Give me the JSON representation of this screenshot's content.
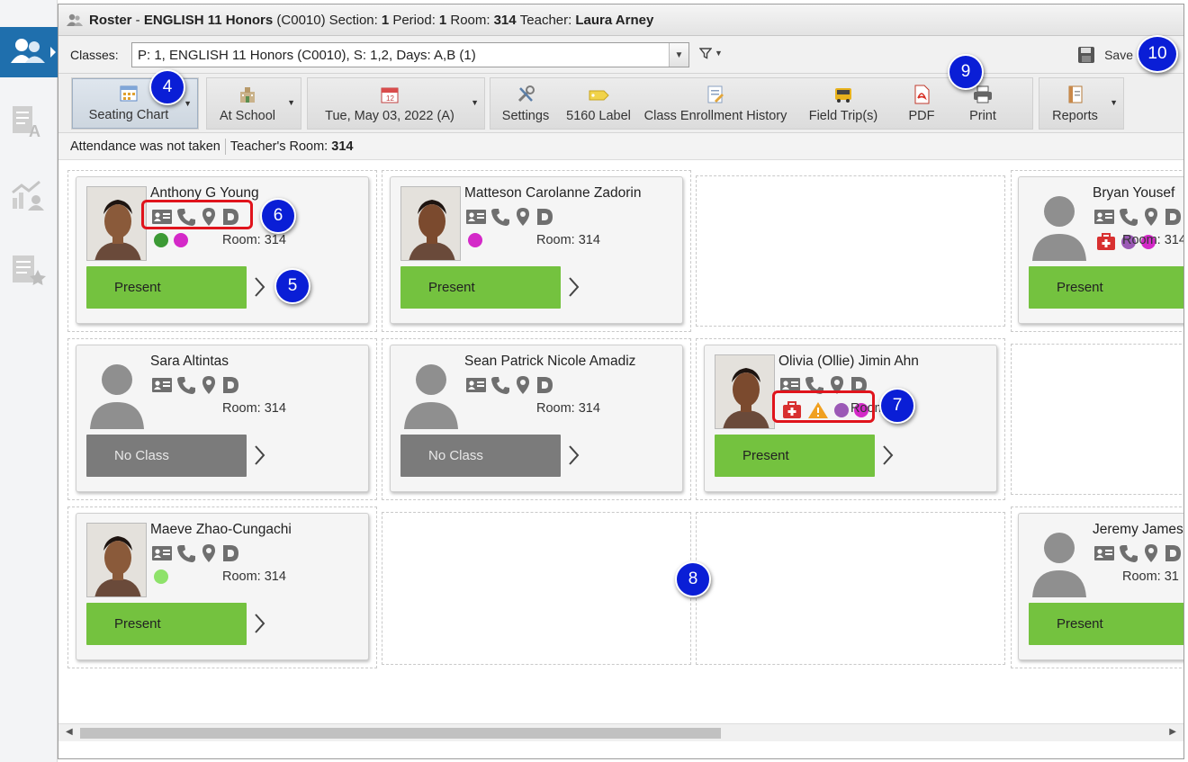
{
  "window": {
    "title_app": "Roster",
    "title_course": "ENGLISH 11 Honors",
    "title_code": "(C0010)",
    "section_label": "Section:",
    "section_value": "1",
    "period_label": "Period:",
    "period_value": "1",
    "room_label": "Room:",
    "room_value": "314",
    "teacher_label": "Teacher:",
    "teacher_value": "Laura Arney"
  },
  "classbar": {
    "label": "Classes:",
    "selected": "P: 1, ENGLISH 11 Honors (C0010), S: 1,2, Days: A,B (1)",
    "save_label": "Save"
  },
  "toolbar": {
    "seating_chart": "Seating Chart",
    "at_school": "At School",
    "date": "Tue, May 03, 2022 (A)",
    "settings": "Settings",
    "label_5160": "5160 Label",
    "enrollment_history": "Class Enrollment History",
    "field_trips": "Field Trip(s)",
    "pdf": "PDF",
    "print": "Print",
    "reports": "Reports"
  },
  "status": {
    "attendance_text": "Attendance was not taken",
    "teacher_room_label": "Teacher's Room:",
    "teacher_room_value": "314"
  },
  "students": [
    {
      "name": "Anthony G Young",
      "room": "Room: 314",
      "status": "Present",
      "dots": [
        "#3c9a35",
        "#d429c8"
      ],
      "photo": "male"
    },
    {
      "name": "Matteson Carolanne Zadorin",
      "room": "Room: 314",
      "status": "Present",
      "dots": [
        "#d429c8"
      ],
      "photo": "female"
    },
    {
      "name": "Bryan Yousef",
      "room": "Room: 314",
      "status": "Present",
      "dots": [
        "#9b59b6",
        "#d429c8"
      ],
      "photo": "none"
    },
    {
      "name": "Sara Altintas",
      "room": "Room: 314",
      "status": "No Class",
      "dots": [],
      "photo": "none"
    },
    {
      "name": "Sean Patrick Nicole Amadiz",
      "room": "Room: 314",
      "status": "No Class",
      "dots": [],
      "photo": "none"
    },
    {
      "name": "Olivia (Ollie) Jimin Ahn",
      "room": "Room: 314",
      "status": "Present",
      "dots": [
        "#9b59b6",
        "#d429c8"
      ],
      "photo": "female"
    },
    {
      "name": "Maeve Zhao-Cungachi",
      "room": "Room: 314",
      "status": "Present",
      "dots": [
        "#8ee26a"
      ],
      "photo": "male"
    },
    {
      "name": "Jeremy James",
      "room": "Room: 31",
      "status": "Present",
      "dots": [],
      "photo": "none"
    }
  ],
  "callouts": [
    "4",
    "5",
    "6",
    "7",
    "8",
    "9",
    "10"
  ],
  "colors": {
    "present": "#74c23f",
    "no_class": "#7b7b7b",
    "callout": "#0a1ed6",
    "highlight": "#e0141c",
    "rail_active": "#1f6fad"
  }
}
